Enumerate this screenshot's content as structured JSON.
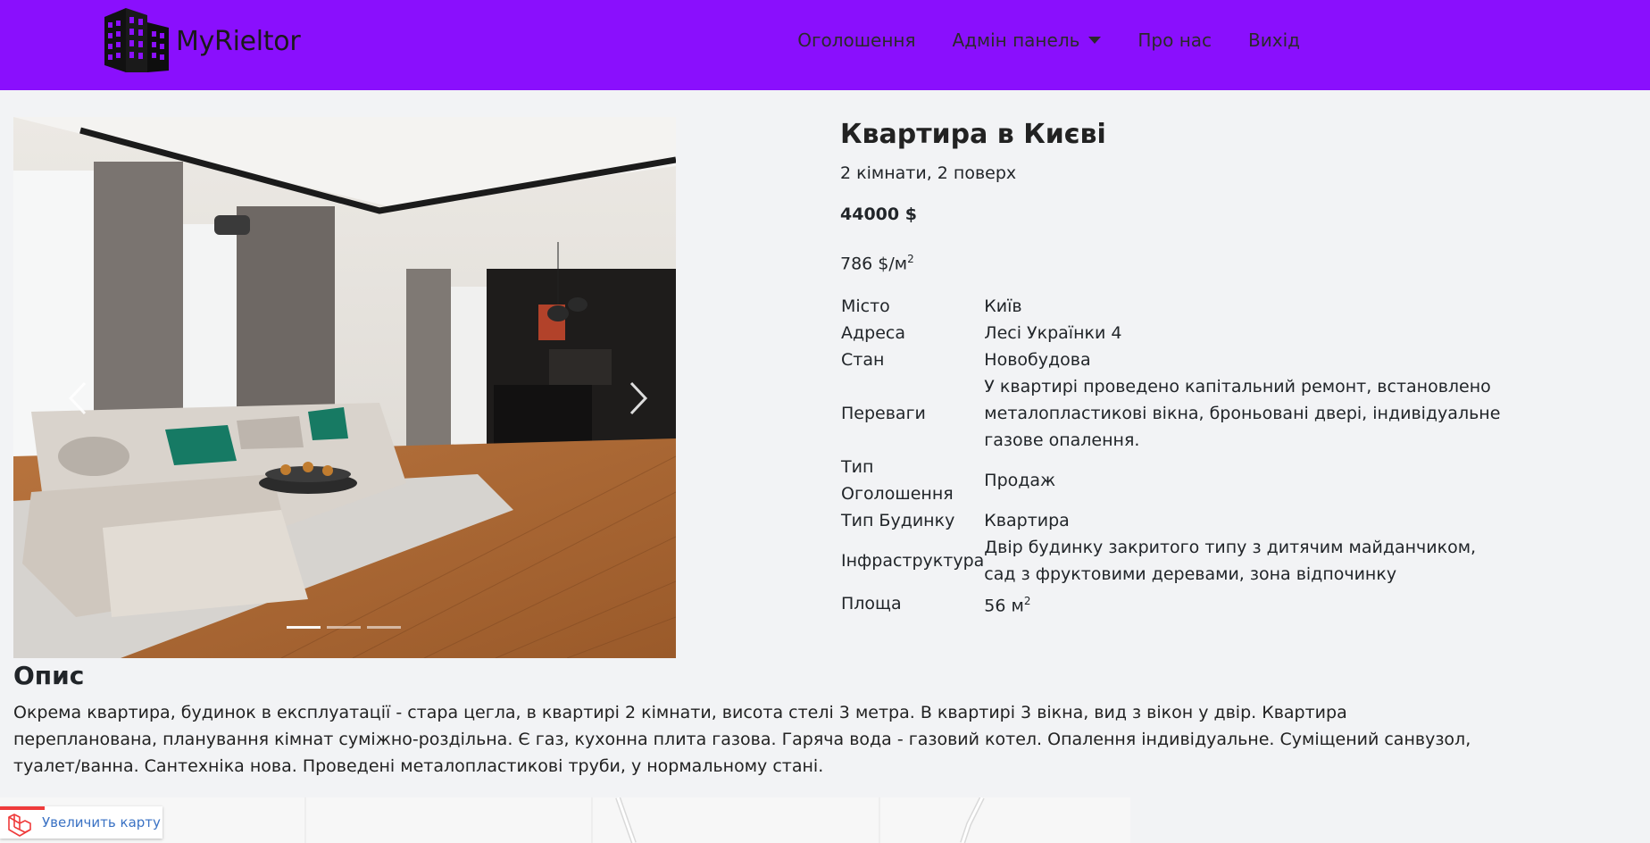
{
  "brand": {
    "name": "MyRieltor",
    "logo_icon": "building-icon"
  },
  "nav": {
    "listings": "Оголошення",
    "admin": "Адмін панель",
    "about": "Про нас",
    "logout": "Вихід"
  },
  "colors": {
    "navbar": "#8a0ffd",
    "background": "#f2f3f5",
    "link": "#3a72c4"
  },
  "carousel": {
    "slides_count": 3,
    "active_index": 0,
    "prev_icon": "chevron-left-icon",
    "next_icon": "chevron-right-icon"
  },
  "listing": {
    "title": "Квартира в Києві",
    "subtitle": "2 кімнати, 2 поверх",
    "price": "44000 $",
    "price_per_m": "786 $/м",
    "price_per_m_sup": "2",
    "properties": [
      {
        "key": "Місто",
        "value": "Київ"
      },
      {
        "key": "Адреса",
        "value": "Лесі Українки 4"
      },
      {
        "key": "Стан",
        "value": "Новобудова"
      },
      {
        "key": "Переваги",
        "value": "У квартирі проведено капітальний ремонт, встановлено металопластикові вікна, броньовані двері, індивідуальне газове опалення."
      },
      {
        "key": "Тип Оголошення",
        "value": "Продаж"
      },
      {
        "key": "Тип Будинку",
        "value": "Квартира"
      },
      {
        "key": "Інфраструктура",
        "value": "Двір будинку закритого типу з дитячим майданчиком, сад з фруктовими деревами, зона відпочинку"
      }
    ],
    "area_label": "Площа",
    "area_value": "56 м",
    "area_sup": "2"
  },
  "description": {
    "heading": "Опис",
    "text": "Окрема квартира, будинок в експлуатації - стара цегла, в квартирі 2 кімнати, висота стелі 3 метра. В квартирі 3 вікна, вид з вікон у двір. Квартира перепланована, планування кімнат суміжно-роздільна. Є газ, кухонна плита газова. Гаряча вода - газовий котел. Опалення індивідуальне. Суміщений санвузол, туалет/ванна. Сантехніка нова. Проведені металопластикові труби, у нормальному стані."
  },
  "map": {
    "enlarge_label": "Увеличить карту",
    "brand_icon": "laravel-icon"
  }
}
